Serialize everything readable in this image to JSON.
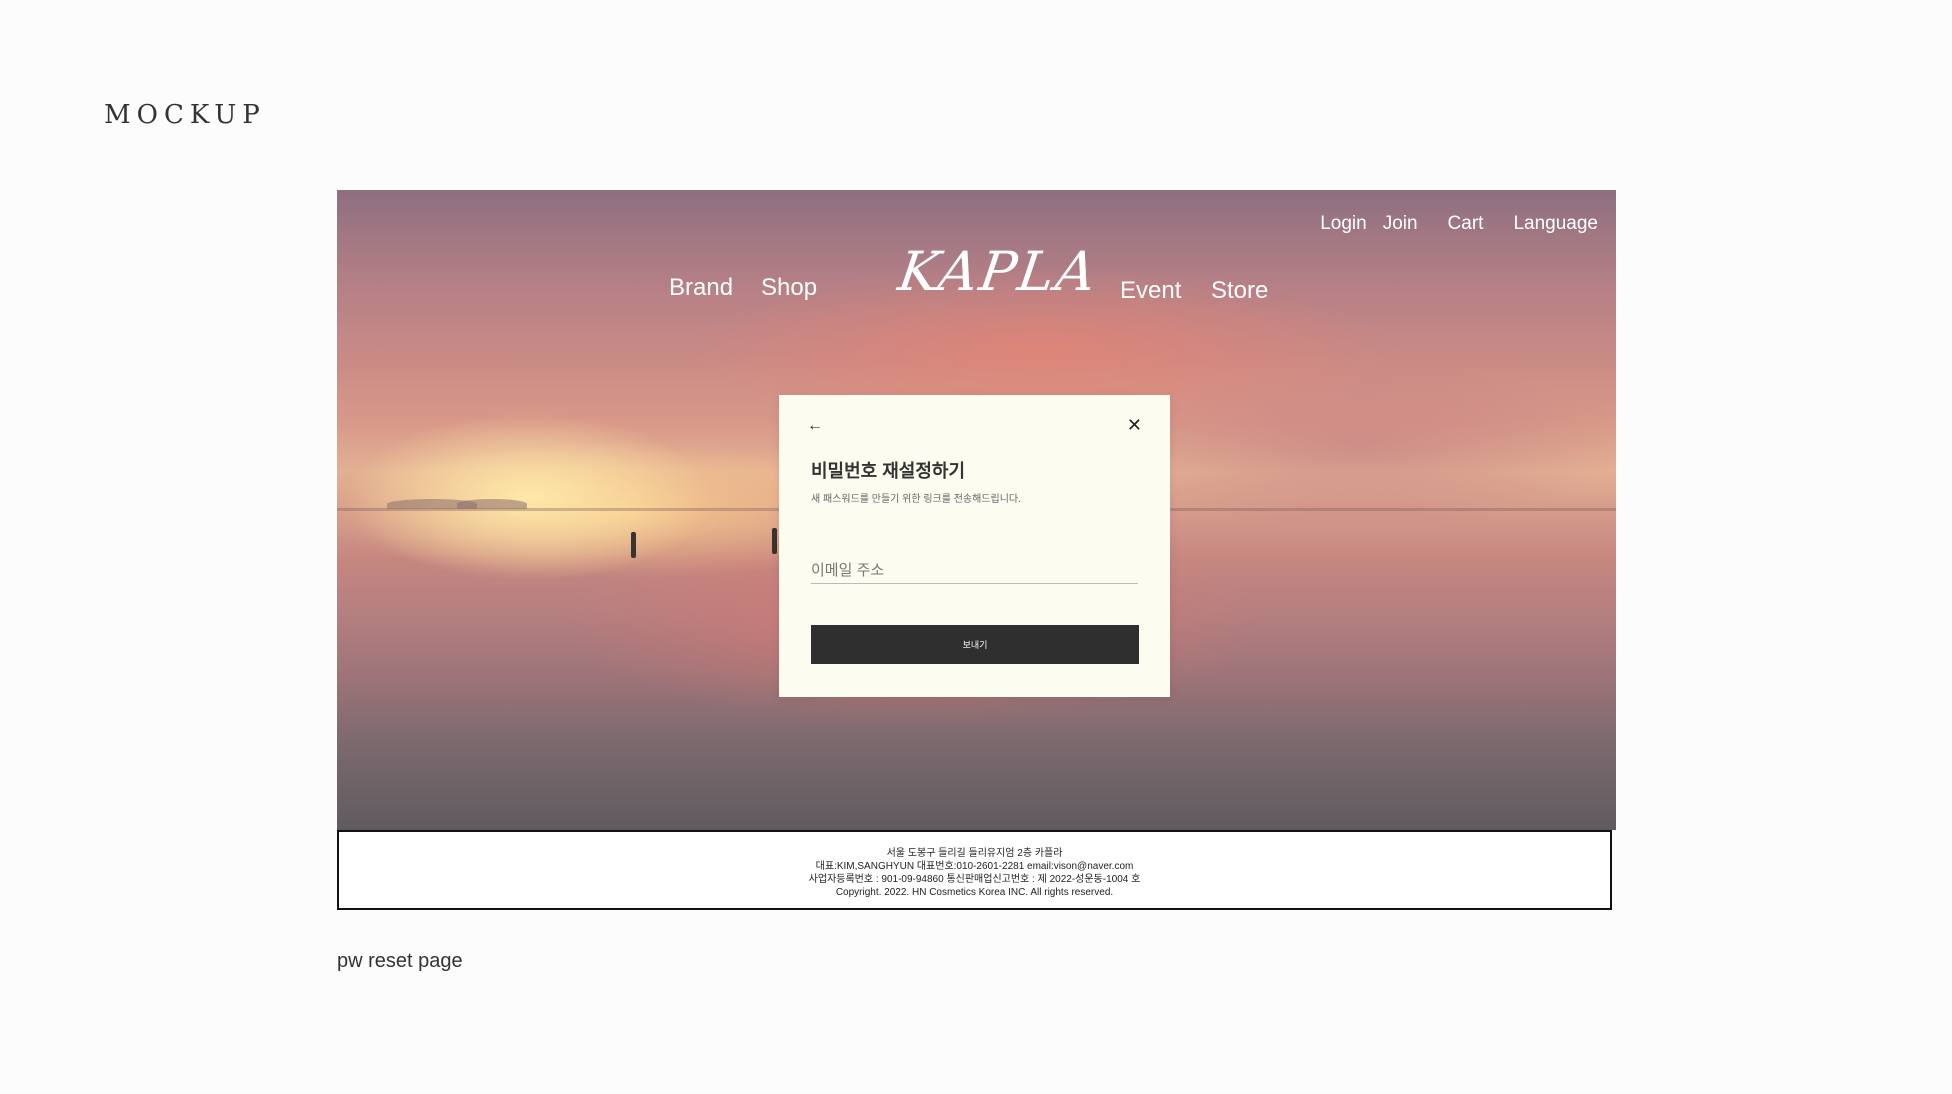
{
  "page": {
    "label": "MOCKUP",
    "caption": "pw reset page"
  },
  "header": {
    "utility_nav": [
      "Login",
      "Join",
      "Cart",
      "Language"
    ],
    "main_nav": {
      "brand": "Brand",
      "shop": "Shop",
      "event": "Event",
      "store": "Store"
    },
    "logo": "KAPLA"
  },
  "modal": {
    "back_icon": "arrow-left-icon",
    "close_icon": "close-icon",
    "title": "비밀번호 재설정하기",
    "subtitle": "새 패스워드를 만들기 위한 링크를 전송해드립니다.",
    "email_placeholder": "이메일 주소",
    "submit_label": "보내기"
  },
  "footer": {
    "lines": [
      "서울 도봉구 들리길 들리유지엄 2층 카플라",
      "대표:KIM,SANGHYUN  대표번호:010-2601-2281 email:vison@naver.com",
      "사업자등록번호 : 901-09-94860  통신판매업신고번호 : 제 2022-성운동-1004 호",
      "Copyright. 2022. HN Cosmetics Korea INC. All rights reserved."
    ]
  },
  "colors": {
    "modal_bg": "#fdfcf0",
    "button_bg": "#2f2f2f",
    "page_bg": "#fcfcfc"
  }
}
